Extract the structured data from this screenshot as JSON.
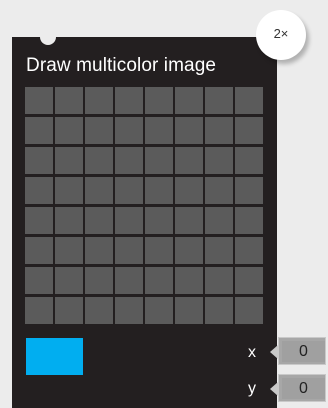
{
  "block": {
    "title": "Draw multicolor image",
    "selected_color": "#01aef0",
    "grid": {
      "rows": 8,
      "cols": 8,
      "cell_color": "#5b5b5b"
    }
  },
  "params": {
    "x": {
      "label": "x",
      "value": "0"
    },
    "y": {
      "label": "y",
      "value": "0"
    }
  },
  "badge": {
    "label": "2×"
  }
}
